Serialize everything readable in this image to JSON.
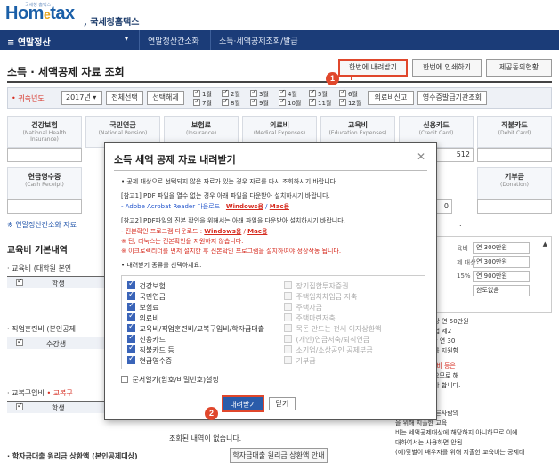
{
  "header": {
    "logo_main": "Hom",
    "logo_e": "e",
    "logo_tax": "tax",
    "logo_sub": ", 국세청홈택스",
    "logo_tiny": "국세청 홈택스"
  },
  "nav": {
    "menu": "≡  연말정산",
    "caret": "▾",
    "crumbs": [
      "연말정산간소화",
      "소득·세액공제조회/발급"
    ]
  },
  "page": {
    "title": "소득 · 세액공제 자료 조회",
    "buttons": [
      "한번에 내려받기",
      "한번에 인쇄하기",
      "제공동의현황"
    ]
  },
  "filter": {
    "year_label": "• 귀속년도",
    "year_value": "2017년 ▾",
    "select_all": "전체선택",
    "deselect": "선택해제",
    "months": [
      "1월",
      "2월",
      "3월",
      "4월",
      "5월",
      "6월",
      "7월",
      "8월",
      "9월",
      "10월",
      "11월",
      "12월"
    ],
    "btn_report": "의료비신고",
    "btn_receipt": "영수증발급기관조회"
  },
  "cards_row1": [
    {
      "t1": "건강보험",
      "t2": "(National Health Insurance)"
    },
    {
      "t1": "국민연금",
      "t2": "(National Pension)"
    },
    {
      "t1": "보험료",
      "t2": "(Insurance)"
    },
    {
      "t1": "의료비",
      "t2": "(Medical Expenses)"
    },
    {
      "t1": "교육비",
      "t2": "(Education Expenses)"
    },
    {
      "t1": "신용카드",
      "t2": "(Credit Card)"
    },
    {
      "t1": "직불카드",
      "t2": "(Debit Card)"
    }
  ],
  "card_values": {
    "credit": "512",
    "other": "0"
  },
  "cards_row2": [
    {
      "t1": "현금영수증",
      "t2": "(Cash Receipt)"
    },
    {
      "t1": "기부금",
      "t2": "(Donation)"
    }
  ],
  "background": {
    "link_left": "※ 연말정산간소화 자료",
    "edu_heading": "교육비 기본내역",
    "edu_sub": "· 교육비 (대학원 본인",
    "col_student": "학생",
    "col_count": "수강생",
    "col_student2": "학생",
    "voc_sub": "· 직업훈련비 (본인공제",
    "uni_sub": "· 교복구입비",
    "uni_sub_red": "• 교복구",
    "no_data": "조회된 내역이 없습니다.",
    "bottom_left": "· 학자금대출 원리금 상환액 (본인공제대상)",
    "bottom_btn": "학자금대출 원리금 상환액 안내",
    "tail_dot": "."
  },
  "right_panel": {
    "r1_label": "육비",
    "r1_value": "연 300만원",
    "r2_label": "제 대상",
    "r2_value": "연 300만원",
    "r3_label": "15%",
    "r3_value": "연 900만원",
    "r4_value": "한도없음",
    "scroll": "▲",
    "text_lines": [
      ": 고등학생 1명당 연 50만원",
      "비 (초중고교육법 제2",
      "육은 학생 1명당 연 30",
      "회 대상 납입자를 지원함"
    ],
    "text2_lines": [
      "(독학한학) 교육비 등은",
      "지 제공되지 않으므로 해",
      "를 발급받 받아야 합니다."
    ],
    "text3_title": "시 사례 예시)",
    "text3_lines": [
      "하는 자료 중 다른사람의",
      "을 위해 지출한 교육",
      "비는 세액공제대상에 해당하지 아니하므로 이에",
      "대하여서는 사용하면 안됨",
      "(예)맞벌이 배우자를 위해 지출한 교육비는 공제대"
    ]
  },
  "modal": {
    "title": "소득 세액 공제 자료 내려받기",
    "close": "✕",
    "line1": "• 공제 대상으로 선택되지 않은 자료가 있는 경우 자료를 다시 조회하시기 바랍니다.",
    "line2": "[참고1] PDF 파일을 열수 없는 경우 아래 파일을 다운받아 설치하시기 바랍니다.",
    "line3_pre": "- Adobe Acrobat Reader 다운로드 : ",
    "line3_win": "Windows용",
    "line3_mid": " / ",
    "line3_mac": "Mac용",
    "line4": "[참고2] PDF파일의 진본 확인을 위해서는 아래 파일을 다운받아 설치하시기 바랍니다.",
    "line5_pre": "- 진본확인 프로그램 다운로드 : ",
    "line5_win": "Windows용",
    "line5_mid": " / ",
    "line5_mac": "Mac용",
    "line6": "※ 단, 리눅스는 진본확인을 지원하지 않습니다.",
    "line7": "※ 이크로렉리더를 먼저 설치한 후 진본확인 프로그램을 설치하여야 정상작동 됩니다.",
    "line8": "• 내려받기 종류를 선택하세요.",
    "left_checks": [
      "건강보험",
      "국민연금",
      "보험료",
      "의료비",
      "교육비/직업훈련비/교복구입비/학자금대출",
      "신용카드",
      "직불카드 등",
      "현금영수증"
    ],
    "right_checks": [
      "장기집합투자증권",
      "주택임차차입금 저축",
      "주택자금",
      "주택마련저축",
      "목돈 안드는 전세 이자상환액",
      "(개인)연금저축/퇴직연금",
      "소기업/소상공인 공제부금",
      "기부금"
    ],
    "pwd_label": "문서열기(암호/비밀번호)설정",
    "download": "내려받기",
    "close_btn": "닫기"
  },
  "badges": [
    "1",
    "2"
  ],
  "colors": {
    "navy": "#1b3c78",
    "accent": "#e0472c",
    "button_blue": "#2a5caa"
  }
}
